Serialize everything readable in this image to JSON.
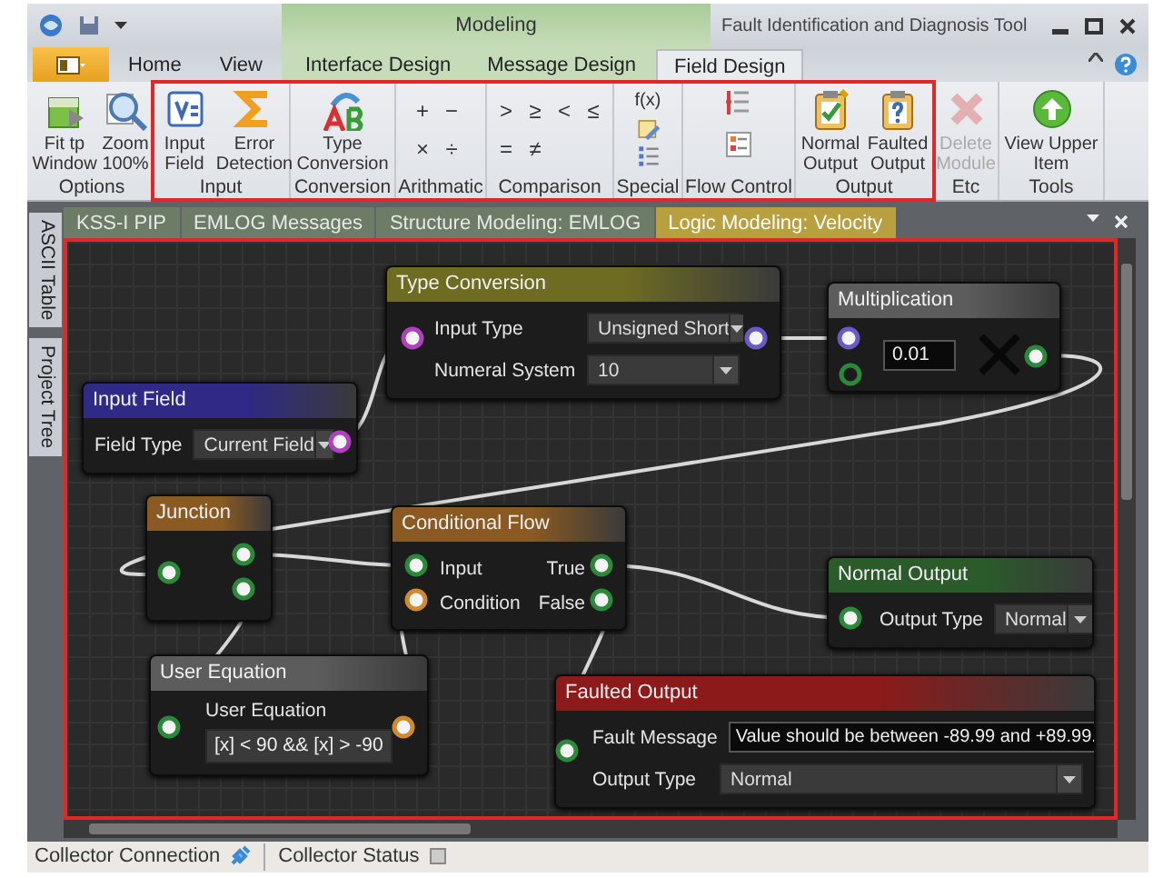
{
  "window": {
    "title": "Fault Identification and Diagnosis Tool",
    "context_group": "Modeling"
  },
  "menu_tabs": [
    {
      "label": "Home",
      "selected": false,
      "context": false
    },
    {
      "label": "View",
      "selected": false,
      "context": false
    },
    {
      "label": "Interface Design",
      "selected": false,
      "context": true
    },
    {
      "label": "Message Design",
      "selected": false,
      "context": true
    },
    {
      "label": "Field Design",
      "selected": true,
      "context": true
    }
  ],
  "ribbon": [
    {
      "label": "Options",
      "items": [
        {
          "kind": "large",
          "label": "Fit tp Window",
          "disabled": false
        },
        {
          "kind": "large",
          "label": "Zoom 100%",
          "disabled": false
        }
      ]
    },
    {
      "label": "Input",
      "items": [
        {
          "kind": "large",
          "label": "Input Field",
          "disabled": false
        },
        {
          "kind": "large",
          "label": "Error Detection",
          "disabled": false
        }
      ]
    },
    {
      "label": "Conversion",
      "items": [
        {
          "kind": "large",
          "label": "Type Conversion",
          "disabled": false
        }
      ]
    },
    {
      "label": "Arithmatic",
      "items": [
        {
          "kind": "symbol",
          "label": "+"
        },
        {
          "kind": "symbol",
          "label": "−"
        },
        {
          "kind": "symbol",
          "label": "×"
        },
        {
          "kind": "symbol",
          "label": "÷"
        }
      ]
    },
    {
      "label": "Comparison",
      "items": [
        {
          "kind": "symbol",
          "label": ">"
        },
        {
          "kind": "symbol",
          "label": "≥"
        },
        {
          "kind": "symbol",
          "label": "<"
        },
        {
          "kind": "symbol",
          "label": "≤"
        },
        {
          "kind": "symbol",
          "label": "="
        },
        {
          "kind": "symbol",
          "label": "≠"
        }
      ]
    },
    {
      "label": "Special",
      "items": [
        {
          "kind": "symbol",
          "label": "f(x)"
        },
        {
          "kind": "icon"
        },
        {
          "kind": "icon"
        }
      ]
    },
    {
      "label": "Flow Control",
      "items": [
        {
          "kind": "icon"
        },
        {
          "kind": "icon"
        }
      ]
    },
    {
      "label": "Output",
      "items": [
        {
          "kind": "large",
          "label": "Normal Output",
          "disabled": false
        },
        {
          "kind": "large",
          "label": "Faulted Output",
          "disabled": false
        }
      ]
    },
    {
      "label": "Etc",
      "items": [
        {
          "kind": "large",
          "label": "Delete Module",
          "disabled": true
        }
      ]
    },
    {
      "label": "Tools",
      "items": [
        {
          "kind": "large",
          "label": "View Upper Item",
          "disabled": false
        }
      ]
    }
  ],
  "side_tabs": [
    "ASCII Table",
    "Project Tree"
  ],
  "doc_tabs": [
    {
      "label": "KSS-I PIP",
      "selected": false
    },
    {
      "label": "EMLOG Messages",
      "selected": false
    },
    {
      "label": "Structure Modeling: EMLOG",
      "selected": false
    },
    {
      "label": "Logic Modeling: Velocity",
      "selected": true
    }
  ],
  "nodes": [
    {
      "title": "Type Conversion",
      "color": "#6e6c22",
      "fields": [
        {
          "label": "Input Type",
          "kind": "dropdown",
          "value": "Unsigned Short"
        },
        {
          "label": "Numeral System",
          "kind": "dropdown",
          "value": "10"
        }
      ]
    },
    {
      "title": "Multiplication",
      "color": "#5c5c5c",
      "fields": [
        {
          "kind": "text",
          "value": "0.01"
        }
      ]
    },
    {
      "title": "Input Field",
      "color": "#2e2a86",
      "fields": [
        {
          "label": "Field Type",
          "kind": "dropdown",
          "value": "Current Field"
        }
      ]
    },
    {
      "title": "Junction",
      "color": "#8a5a22"
    },
    {
      "title": "Conditional Flow",
      "color": "#8a5a22",
      "inputs": [
        "Input",
        "Condition"
      ],
      "outputs": [
        "True",
        "False"
      ]
    },
    {
      "title": "Normal Output",
      "color": "#2b5a2b",
      "fields": [
        {
          "label": "Output Type",
          "kind": "dropdown",
          "value": "Normal"
        }
      ]
    },
    {
      "title": "User Equation",
      "color": "#5c5c5c",
      "fields": [
        {
          "label": "User Equation",
          "kind": "text",
          "value": "[x] < 90 && [x] > -90"
        }
      ]
    },
    {
      "title": "Faulted Output",
      "color": "#8c1a1a",
      "fields": [
        {
          "label": "Fault Message",
          "kind": "text",
          "value": "Value should be between -89.99 and +89.99."
        },
        {
          "label": "Output Type",
          "kind": "dropdown",
          "value": "Normal"
        }
      ]
    }
  ],
  "status_bar": [
    "Collector Connection",
    "Collector Status"
  ]
}
